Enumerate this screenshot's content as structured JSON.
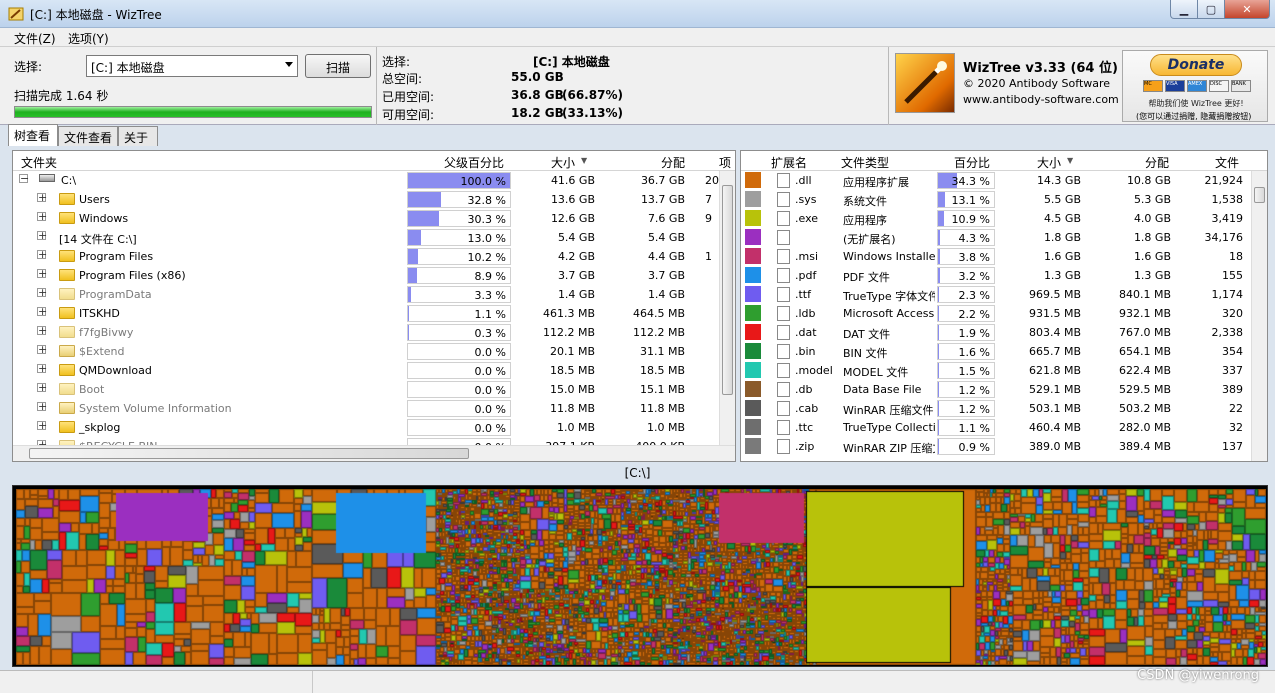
{
  "window": {
    "title": "[C:] 本地磁盘 - WizTree"
  },
  "menu": [
    "文件(Z)",
    "选项(Y)"
  ],
  "scan": {
    "select_label": "选择:",
    "combo_value": "[C:] 本地磁盘",
    "scan_button": "扫描",
    "status": "扫描完成 1.64 秒",
    "progress": 1.0
  },
  "drive": {
    "select_label": "选择:",
    "select_value": "[C:]  本地磁盘",
    "total_label": "总空间:",
    "total_value": "55.0 GB",
    "used_label": "已用空间:",
    "used_value": "36.8 GB",
    "used_pct": "(66.87%)",
    "free_label": "可用空间:",
    "free_value": "18.2 GB",
    "free_pct": "(33.13%)"
  },
  "about": {
    "name": "WizTree v3.33 (64 位)",
    "copyright": "© 2020 Antibody Software",
    "url": "www.antibody-software.com"
  },
  "donate": {
    "button": "Donate",
    "caption": "帮助我们使 WizTree 更好!",
    "note": "(您可以通过捐赠, 隐藏捐赠按钮)",
    "cards": [
      "MC",
      "VISA",
      "AMEX",
      "DISC",
      "BANK"
    ]
  },
  "tabs": [
    "树查看",
    "文件查看",
    "关于"
  ],
  "tree": {
    "headers": {
      "folder": "文件夹",
      "pct": "父级百分比",
      "size": "大小",
      "alloc": "分配",
      "items": "项"
    },
    "rows": [
      {
        "name": "C:\\",
        "type": "drive",
        "pct": 1.0,
        "pct_label": "100.0 %",
        "size": "41.6 GB",
        "alloc": "36.7 GB",
        "items": "20"
      },
      {
        "name": "Users",
        "type": "folder",
        "pct": 0.328,
        "pct_label": "32.8 %",
        "size": "13.6 GB",
        "alloc": "13.7 GB",
        "items": "7"
      },
      {
        "name": "Windows",
        "type": "folder",
        "pct": 0.303,
        "pct_label": "30.3 %",
        "size": "12.6 GB",
        "alloc": "7.6 GB",
        "items": "9"
      },
      {
        "name": "[14 文件在 C:\\]",
        "type": "files",
        "pct": 0.13,
        "pct_label": "13.0 %",
        "size": "5.4 GB",
        "alloc": "5.4 GB",
        "items": ""
      },
      {
        "name": "Program Files",
        "type": "folder",
        "pct": 0.102,
        "pct_label": "10.2 %",
        "size": "4.2 GB",
        "alloc": "4.4 GB",
        "items": "1"
      },
      {
        "name": "Program Files (x86)",
        "type": "folder",
        "pct": 0.089,
        "pct_label": "8.9 %",
        "size": "3.7 GB",
        "alloc": "3.7 GB",
        "items": ""
      },
      {
        "name": "ProgramData",
        "type": "folder-dim",
        "pct": 0.033,
        "pct_label": "3.3 %",
        "size": "1.4 GB",
        "alloc": "1.4 GB",
        "items": ""
      },
      {
        "name": "ITSKHD",
        "type": "folder",
        "pct": 0.011,
        "pct_label": "1.1 %",
        "size": "461.3 MB",
        "alloc": "464.5 MB",
        "items": ""
      },
      {
        "name": "f7fgBivwy",
        "type": "folder-dim",
        "pct": 0.003,
        "pct_label": "0.3 %",
        "size": "112.2 MB",
        "alloc": "112.2 MB",
        "items": ""
      },
      {
        "name": "$Extend",
        "type": "folder-gear",
        "pct": 0.0,
        "pct_label": "0.0 %",
        "size": "20.1 MB",
        "alloc": "31.1 MB",
        "items": ""
      },
      {
        "name": "QMDownload",
        "type": "folder",
        "pct": 0.0,
        "pct_label": "0.0 %",
        "size": "18.5 MB",
        "alloc": "18.5 MB",
        "items": ""
      },
      {
        "name": "Boot",
        "type": "folder-dim",
        "pct": 0.0,
        "pct_label": "0.0 %",
        "size": "15.0 MB",
        "alloc": "15.1 MB",
        "items": ""
      },
      {
        "name": "System Volume Information",
        "type": "folder-gear",
        "pct": 0.0,
        "pct_label": "0.0 %",
        "size": "11.8 MB",
        "alloc": "11.8 MB",
        "items": ""
      },
      {
        "name": "_skplog",
        "type": "folder",
        "pct": 0.0,
        "pct_label": "0.0 %",
        "size": "1.0 MB",
        "alloc": "1.0 MB",
        "items": ""
      },
      {
        "name": "$RECYCLE.BIN",
        "type": "folder-dim",
        "pct": 0.0,
        "pct_label": "0.0 %",
        "size": "397.1 KB",
        "alloc": "400.0 KB",
        "items": ""
      }
    ]
  },
  "ext": {
    "headers": {
      "ext": "扩展名",
      "type": "文件类型",
      "pct": "百分比",
      "size": "大小",
      "alloc": "分配",
      "files": "文件"
    },
    "rows": [
      {
        "color": "#d06a0a",
        "ext": ".dll",
        "type": "应用程序扩展",
        "pct": 0.343,
        "pct_label": "34.3 %",
        "size": "14.3 GB",
        "alloc": "10.8 GB",
        "files": "21,924"
      },
      {
        "color": "#9e9e9e",
        "ext": ".sys",
        "type": "系统文件",
        "pct": 0.131,
        "pct_label": "13.1 %",
        "size": "5.5 GB",
        "alloc": "5.3 GB",
        "files": "1,538"
      },
      {
        "color": "#b8c20a",
        "ext": ".exe",
        "type": "应用程序",
        "pct": 0.109,
        "pct_label": "10.9 %",
        "size": "4.5 GB",
        "alloc": "4.0 GB",
        "files": "3,419"
      },
      {
        "color": "#9b2fc0",
        "ext": "",
        "type": "(无扩展名)",
        "pct": 0.043,
        "pct_label": "4.3 %",
        "size": "1.8 GB",
        "alloc": "1.8 GB",
        "files": "34,176"
      },
      {
        "color": "#c2306a",
        "ext": ".msi",
        "type": "Windows Installer",
        "pct": 0.038,
        "pct_label": "3.8 %",
        "size": "1.6 GB",
        "alloc": "1.6 GB",
        "files": "18"
      },
      {
        "color": "#1e90e8",
        "ext": ".pdf",
        "type": "PDF 文件",
        "pct": 0.032,
        "pct_label": "3.2 %",
        "size": "1.3 GB",
        "alloc": "1.3 GB",
        "files": "155"
      },
      {
        "color": "#6f5cf0",
        "ext": ".ttf",
        "type": "TrueType 字体文件",
        "pct": 0.023,
        "pct_label": "2.3 %",
        "size": "969.5 MB",
        "alloc": "840.1 MB",
        "files": "1,174"
      },
      {
        "color": "#2f9e2f",
        "ext": ".ldb",
        "type": "Microsoft Access Record-Locking Information",
        "pct": 0.022,
        "pct_label": "2.2 %",
        "size": "931.5 MB",
        "alloc": "932.1 MB",
        "files": "320"
      },
      {
        "color": "#e81818",
        "ext": ".dat",
        "type": "DAT 文件",
        "pct": 0.019,
        "pct_label": "1.9 %",
        "size": "803.4 MB",
        "alloc": "767.0 MB",
        "files": "2,338"
      },
      {
        "color": "#1a8a3a",
        "ext": ".bin",
        "type": "BIN 文件",
        "pct": 0.016,
        "pct_label": "1.6 %",
        "size": "665.7 MB",
        "alloc": "654.1 MB",
        "files": "354"
      },
      {
        "color": "#22c8b0",
        "ext": ".model",
        "type": "MODEL 文件",
        "pct": 0.015,
        "pct_label": "1.5 %",
        "size": "621.8 MB",
        "alloc": "622.4 MB",
        "files": "337"
      },
      {
        "color": "#8a5a2a",
        "ext": ".db",
        "type": "Data Base File",
        "pct": 0.012,
        "pct_label": "1.2 %",
        "size": "529.1 MB",
        "alloc": "529.5 MB",
        "files": "389"
      },
      {
        "color": "#5a5a5a",
        "ext": ".cab",
        "type": "WinRAR 压缩文件",
        "pct": 0.012,
        "pct_label": "1.2 %",
        "size": "503.1 MB",
        "alloc": "503.2 MB",
        "files": "22"
      },
      {
        "color": "#6e6e6e",
        "ext": ".ttc",
        "type": "TrueType Collection",
        "pct": 0.011,
        "pct_label": "1.1 %",
        "size": "460.4 MB",
        "alloc": "282.0 MB",
        "files": "32"
      },
      {
        "color": "#7a7a7a",
        "ext": ".zip",
        "type": "WinRAR ZIP 压缩文件",
        "pct": 0.009,
        "pct_label": "0.9 %",
        "size": "389.0 MB",
        "alloc": "389.4 MB",
        "files": "137"
      }
    ]
  },
  "treemap": {
    "label": "[C:\\]",
    "palette": [
      "#d06a0a",
      "#9e9e9e",
      "#b8c20a",
      "#9b2fc0",
      "#c2306a",
      "#1e90e8",
      "#6f5cf0",
      "#2f9e2f",
      "#e81818",
      "#1a8a3a",
      "#22c8b0",
      "#5a5a5a"
    ]
  },
  "watermark": "CSDN @yiwenrong"
}
